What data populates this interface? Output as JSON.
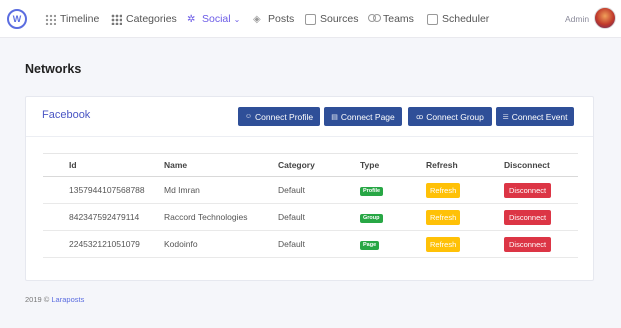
{
  "logo_text": "W",
  "nav": {
    "items": [
      {
        "label": "Timeline",
        "icon": "grid-icon"
      },
      {
        "label": "Categories",
        "icon": "grid-icon"
      },
      {
        "label": "Social",
        "icon": "network-icon",
        "active": true,
        "dropdown": true
      },
      {
        "label": "Posts",
        "icon": "layers-icon"
      },
      {
        "label": "Sources",
        "icon": "monitor-icon"
      },
      {
        "label": "Teams",
        "icon": "people-icon"
      },
      {
        "label": "Scheduler",
        "icon": "calendar-icon"
      }
    ],
    "admin_label": "Admin"
  },
  "page": {
    "title": "Networks"
  },
  "card": {
    "title": "Facebook",
    "buttons": [
      {
        "label": "Connect Profile",
        "icon": "user-icon"
      },
      {
        "label": "Connect Page",
        "icon": "page-icon"
      },
      {
        "label": "Connect Group",
        "icon": "group-icon"
      },
      {
        "label": "Connect Event",
        "icon": "list-icon"
      }
    ]
  },
  "table": {
    "headers": [
      "Id",
      "Name",
      "Category",
      "Type",
      "Refresh",
      "Disconnect"
    ],
    "rows": [
      {
        "id": "1357944107568788",
        "name": "Md Imran",
        "category": "Default",
        "type": "Profile",
        "refresh": "Refresh",
        "disconnect": "Disconnect"
      },
      {
        "id": "842347592479114",
        "name": "Raccord Technologies",
        "category": "Default",
        "type": "Group",
        "refresh": "Refresh",
        "disconnect": "Disconnect"
      },
      {
        "id": "224532121051079",
        "name": "Kodoinfo",
        "category": "Default",
        "type": "Page",
        "refresh": "Refresh",
        "disconnect": "Disconnect"
      }
    ]
  },
  "footer": {
    "text": "2019 ©",
    "link": "Laraposts"
  },
  "colors": {
    "primary_button": "#2f4f98",
    "accent": "#6c5ce7",
    "badge": "#28a745",
    "refresh": "#ffc107",
    "disconnect": "#dc3545"
  }
}
